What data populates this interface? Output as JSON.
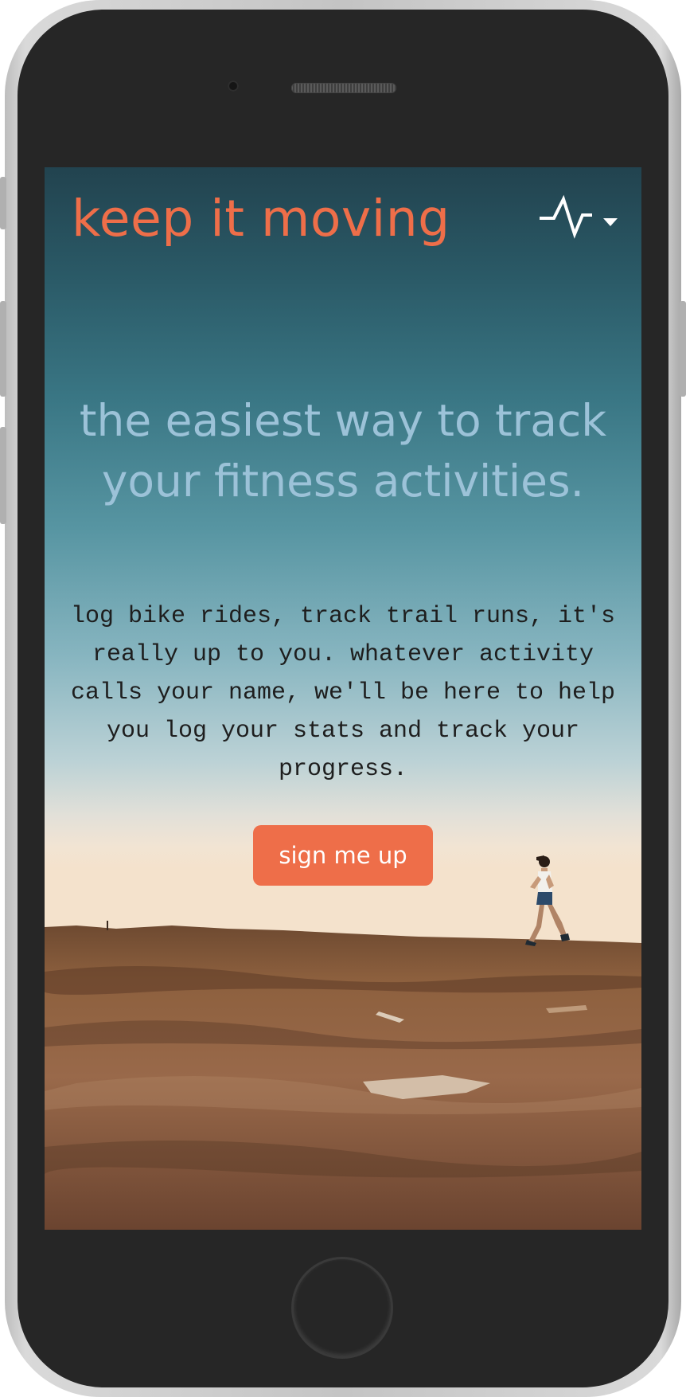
{
  "header": {
    "brand": "keep it moving",
    "menu_icon": "activity-pulse-icon",
    "caret_icon": "caret-down-icon"
  },
  "hero": {
    "heading": "the easiest way to track your fitness activities.",
    "body": "log bike rides, track trail runs, it's really up to you. whatever activity calls your name, we'll be here to help you log your stats and track your progress.",
    "cta_label": "sign me up"
  },
  "colors": {
    "brand_orange": "#ee6e49",
    "heading_blue": "#9cc2d8",
    "body_text": "#1e1e1e",
    "phone_body": "#262626",
    "sky_top": "#22434f",
    "ground": "#8a5a36"
  }
}
